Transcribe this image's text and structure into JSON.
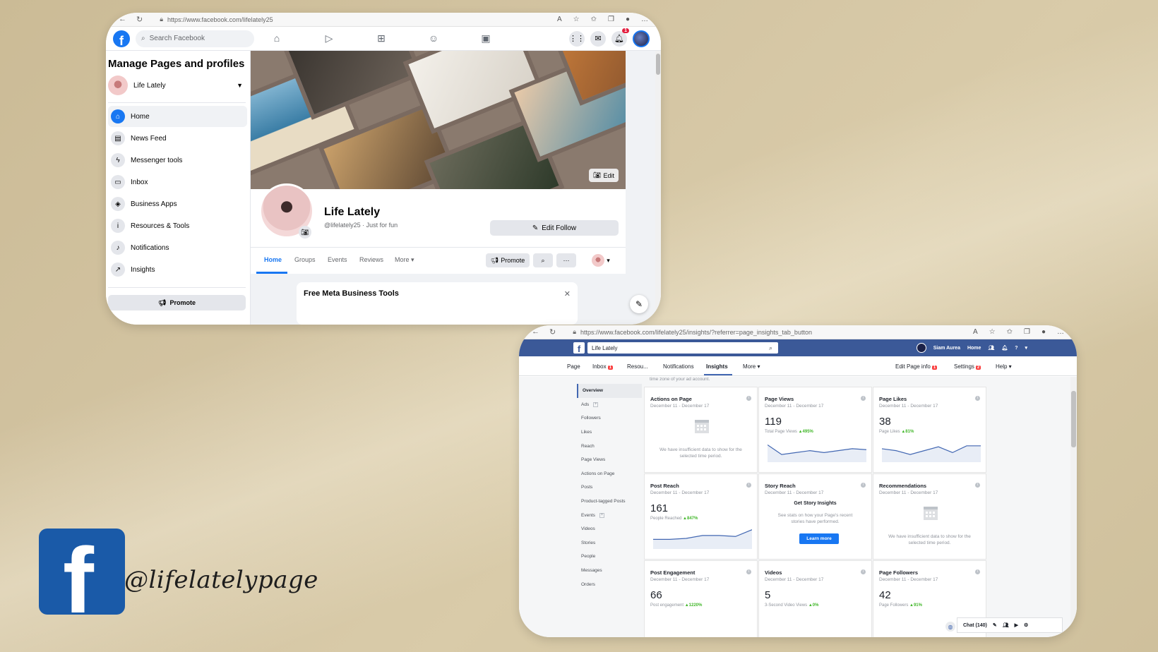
{
  "window1": {
    "browser": {
      "url": "https://www.facebook.com/lifelately25"
    },
    "search_placeholder": "Search Facebook",
    "notification_count": "1",
    "sidebar": {
      "title": "Manage Pages and profiles",
      "page_name": "Life Lately",
      "items": [
        {
          "label": "Home",
          "icon": "home-icon"
        },
        {
          "label": "News Feed",
          "icon": "news-feed-icon"
        },
        {
          "label": "Messenger tools",
          "icon": "messenger-icon"
        },
        {
          "label": "Inbox",
          "icon": "inbox-icon"
        },
        {
          "label": "Business Apps",
          "icon": "cube-icon"
        },
        {
          "label": "Resources & Tools",
          "icon": "info-icon"
        },
        {
          "label": "Notifications",
          "icon": "bell-icon"
        },
        {
          "label": "Insights",
          "icon": "trend-icon"
        }
      ],
      "promote_label": "Promote"
    },
    "cover_edit_label": "Edit",
    "profile": {
      "name": "Life Lately",
      "handle": "@lifelately25 · Just for fun",
      "edit_follow_label": "Edit Follow"
    },
    "tabs": [
      "Home",
      "Groups",
      "Events",
      "Reviews",
      "More"
    ],
    "promote_button": "Promote",
    "card_title": "Free Meta Business Tools"
  },
  "window2": {
    "browser": {
      "url": "https://www.facebook.com/lifelately25/insights/?referrer=page_insights_tab_button"
    },
    "search_value": "Life Lately",
    "user_name": "Siam Aurea",
    "home_label": "Home",
    "subnav": {
      "page": "Page",
      "inbox": "Inbox",
      "inbox_count": "1",
      "resources": "Resou...",
      "notifications": "Notifications",
      "insights": "Insights",
      "more": "More",
      "edit_page_info": "Edit Page info",
      "edit_count": "1",
      "settings": "Settings",
      "settings_count": "2",
      "help": "Help"
    },
    "top_note": "time zone of your ad account.",
    "leftnav": [
      "Overview",
      "Ads",
      "Followers",
      "Likes",
      "Reach",
      "Page Views",
      "Actions on Page",
      "Posts",
      "Product-tagged Posts",
      "Events",
      "Videos",
      "Stories",
      "People",
      "Messages",
      "Orders"
    ],
    "date_range": "December 11 - December 17",
    "tiles": {
      "actions": {
        "title": "Actions on Page",
        "empty": "We have insufficient data to show for the selected time period."
      },
      "page_views": {
        "title": "Page Views",
        "value": "119",
        "sub": "Total Page Views",
        "change": "▲495%"
      },
      "page_likes": {
        "title": "Page Likes",
        "value": "38",
        "sub": "Page Likes",
        "change": "▲81%"
      },
      "post_reach": {
        "title": "Post Reach",
        "value": "161",
        "sub": "People Reached",
        "change": "▲847%"
      },
      "story_reach": {
        "title": "Story Reach",
        "heading": "Get Story Insights",
        "desc": "See stats on how your Page's recent stories have performed.",
        "button": "Learn more"
      },
      "recommendations": {
        "title": "Recommendations",
        "empty": "We have insufficient data to show for the selected time period."
      },
      "post_engagement": {
        "title": "Post Engagement",
        "value": "66",
        "sub": "Post engagement",
        "change": "▲1220%"
      },
      "videos": {
        "title": "Videos",
        "value": "5",
        "sub": "3-Second Video Views",
        "change": "▲0%"
      },
      "page_followers": {
        "title": "Page Followers",
        "value": "42",
        "sub": "Page Followers",
        "change": "▲91%"
      }
    },
    "sparklines": {
      "page_views": [
        18,
        8,
        10,
        12,
        10,
        12,
        14,
        13
      ],
      "page_likes": [
        14,
        12,
        8,
        12,
        16,
        10,
        17,
        17
      ],
      "post_reach": [
        10,
        10,
        11,
        14,
        14,
        13,
        20
      ]
    },
    "chat_label": "Chat (140)"
  },
  "brand": {
    "handle": "@lifelatelypage"
  },
  "colors": {
    "facebook_blue": "#1877f2",
    "classic_blue": "#3b5998",
    "up_green": "#42b72a",
    "background": "#d3c4a2"
  }
}
